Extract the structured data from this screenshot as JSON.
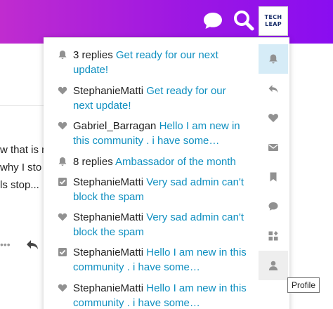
{
  "header": {
    "logo_line1": "TECH",
    "logo_line2": "LEAP",
    "icons": {
      "chat": "chat-bubble-icon",
      "search": "search-icon"
    }
  },
  "background_post": {
    "line1": "w that is n",
    "line2": " why I sto",
    "line3": "ls stop...",
    "dots": "•••"
  },
  "notifications": [
    {
      "icon": "bell-icon",
      "user": "3 replies",
      "title": "Get ready for our next update!"
    },
    {
      "icon": "heart-icon",
      "user": "StephanieMatti",
      "title": "Get ready for our next update!"
    },
    {
      "icon": "heart-icon",
      "user": "Gabriel_Barragan",
      "title": "Hello I am new in this community . i have some…"
    },
    {
      "icon": "bell-icon",
      "user": "8 replies",
      "title": "Ambassador of the month"
    },
    {
      "icon": "checkbox-icon",
      "user": "StephanieMatti",
      "title": "Very sad admin can't block the spam"
    },
    {
      "icon": "heart-icon",
      "user": "StephanieMatti",
      "title": "Very sad admin can't block the spam"
    },
    {
      "icon": "checkbox-icon",
      "user": "StephanieMatti",
      "title": "Hello I am new in this community . i have some…"
    },
    {
      "icon": "heart-icon",
      "user": "StephanieMatti",
      "title": "Hello I am new in this community . i have some…"
    }
  ],
  "rail": [
    "bell-icon",
    "reply-icon",
    "heart-icon",
    "envelope-icon",
    "bookmark-icon",
    "chat-bubble-icon",
    "badge-icon",
    "user-icon"
  ],
  "tooltip": "Profile",
  "colors": {
    "header_start": "#c02ccf",
    "header_end": "#8a0df0",
    "link": "#0f8fc0",
    "active_tab": "#d6ecf7",
    "icon_gray": "#919191"
  }
}
